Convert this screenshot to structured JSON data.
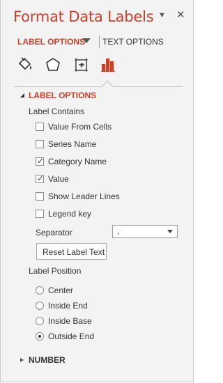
{
  "pane": {
    "title": "Format Data Labels",
    "menu_icon": "chevron-down-icon",
    "close_icon": "close-icon"
  },
  "tabs": {
    "active_label": "LABEL OPTIONS",
    "inactive_label": "TEXT OPTIONS"
  },
  "icon_tabs": [
    {
      "name": "fill-line-icon"
    },
    {
      "name": "effects-icon"
    },
    {
      "name": "size-properties-icon"
    },
    {
      "name": "label-options-icon"
    }
  ],
  "section": {
    "heading": "LABEL OPTIONS",
    "label_contains": "Label Contains",
    "checkboxes": [
      {
        "label": "Value From Cells",
        "checked": false
      },
      {
        "label": "Series Name",
        "checked": false
      },
      {
        "label": "Category Name",
        "checked": true
      },
      {
        "label": "Value",
        "checked": true
      },
      {
        "label": "Show Leader Lines",
        "checked": false
      },
      {
        "label": "Legend key",
        "checked": false
      }
    ],
    "separator_label": "Separator",
    "separator_value": ",",
    "reset_button": "Reset Label Text",
    "label_position": "Label Position",
    "radios": [
      {
        "label": "Center",
        "selected": false
      },
      {
        "label": "Inside End",
        "selected": false
      },
      {
        "label": "Inside Base",
        "selected": false
      },
      {
        "label": "Outside End",
        "selected": true
      }
    ]
  },
  "number_section": {
    "heading": "NUMBER"
  },
  "colors": {
    "accent": "#c7422b",
    "panel_bg": "#f3f3f3"
  }
}
